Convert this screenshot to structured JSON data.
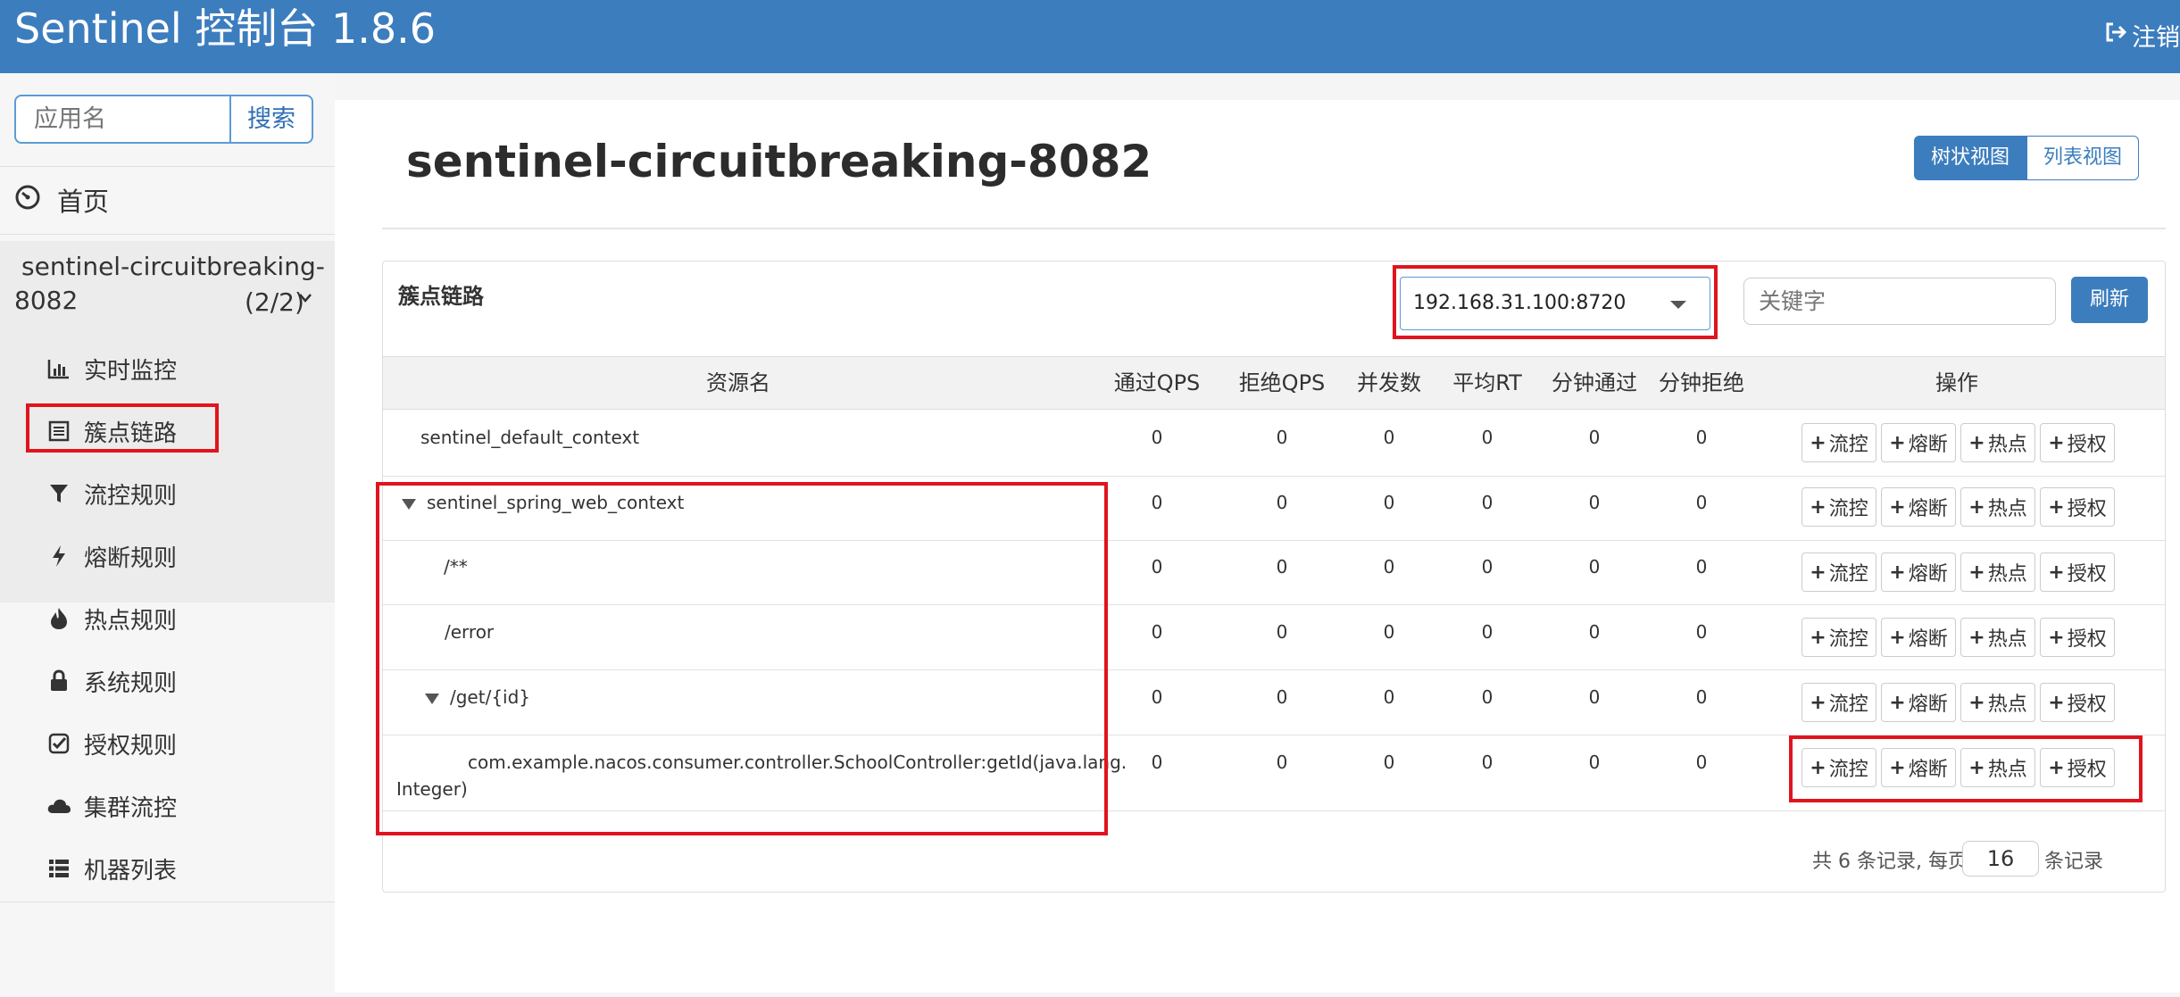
{
  "header": {
    "brand": "Sentinel 控制台 1.8.6",
    "logout_label": "注销"
  },
  "sidebar": {
    "search_placeholder": "应用名",
    "search_button": "搜索",
    "home_label": "首页",
    "app_name_line1": "sentinel-circuitbreaking-",
    "app_name_line2": "8082",
    "app_count": "(2/2)",
    "menu": [
      {
        "label": "实时监控",
        "icon": "bar-chart-icon"
      },
      {
        "label": "簇点链路",
        "icon": "list-alt-icon"
      },
      {
        "label": "流控规则",
        "icon": "filter-icon"
      },
      {
        "label": "熔断规则",
        "icon": "flash-icon"
      },
      {
        "label": "热点规则",
        "icon": "fire-icon"
      },
      {
        "label": "系统规则",
        "icon": "lock-icon"
      },
      {
        "label": "授权规则",
        "icon": "check-icon"
      },
      {
        "label": "集群流控",
        "icon": "cloud-icon"
      },
      {
        "label": "机器列表",
        "icon": "th-list-icon"
      }
    ]
  },
  "main": {
    "title": "sentinel-circuitbreaking-8082",
    "view_tree": "树状视图",
    "view_list": "列表视图",
    "panel_title": "簇点链路",
    "machine": "192.168.31.100:8720",
    "keyword_placeholder": "关键字",
    "refresh": "刷新",
    "columns": [
      "资源名",
      "通过QPS",
      "拒绝QPS",
      "并发数",
      "平均RT",
      "分钟通过",
      "分钟拒绝",
      "操作"
    ],
    "rows": [
      {
        "name": "sentinel_default_context",
        "values": [
          "0",
          "0",
          "0",
          "0",
          "0",
          "0"
        ]
      },
      {
        "name": "sentinel_spring_web_context",
        "values": [
          "0",
          "0",
          "0",
          "0",
          "0",
          "0"
        ]
      },
      {
        "name": "/**",
        "values": [
          "0",
          "0",
          "0",
          "0",
          "0",
          "0"
        ]
      },
      {
        "name": "/error",
        "values": [
          "0",
          "0",
          "0",
          "0",
          "0",
          "0"
        ]
      },
      {
        "name": "/get/{id}",
        "values": [
          "0",
          "0",
          "0",
          "0",
          "0",
          "0"
        ]
      },
      {
        "name_line1": "com.example.nacos.consumer.controller.SchoolController:getId(java.lang.",
        "name_line2": "Integer)",
        "values": [
          "0",
          "0",
          "0",
          "0",
          "0",
          "0"
        ]
      }
    ],
    "op_buttons": [
      "流控",
      "熔断",
      "热点",
      "授权"
    ],
    "footer_prefix": "共 6 条记录, 每页",
    "page_size": "16",
    "footer_suffix": "条记录"
  }
}
